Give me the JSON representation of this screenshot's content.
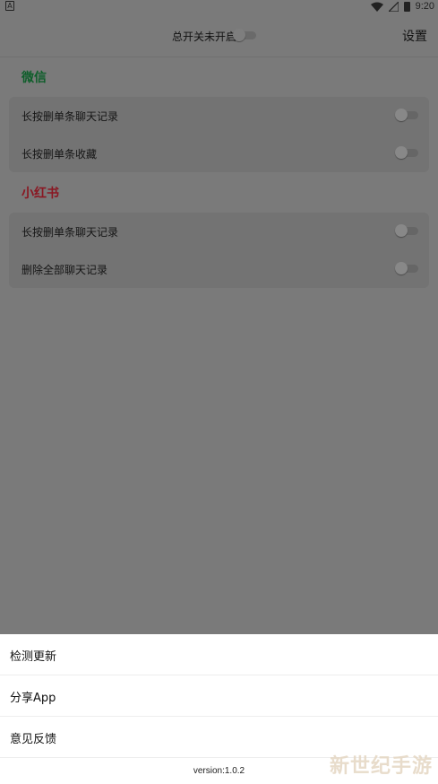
{
  "status_bar": {
    "time": "9:20",
    "left_icon": "A"
  },
  "app_bar": {
    "master_switch_label": "总开关未开启",
    "settings_label": "设置",
    "master_switch_on": false
  },
  "sections": [
    {
      "title": "微信",
      "color": "#0e5e2a",
      "items": [
        {
          "label": "长按删单条聊天记录",
          "enabled": false
        },
        {
          "label": "长按删单条收藏",
          "enabled": false
        }
      ]
    },
    {
      "title": "小红书",
      "color": "#8a1722",
      "items": [
        {
          "label": "长按删单条聊天记录",
          "enabled": false
        },
        {
          "label": "删除全部聊天记录",
          "enabled": false
        }
      ]
    }
  ],
  "bottom_sheet": {
    "items": [
      {
        "label": "检测更新"
      },
      {
        "label": "分享App"
      },
      {
        "label": "意见反馈"
      }
    ],
    "version": "version:1.0.2"
  },
  "watermark": "新世纪手游",
  "icons": {
    "wifi": "wifi-icon",
    "signal": "signal-icon",
    "battery": "battery-icon"
  }
}
